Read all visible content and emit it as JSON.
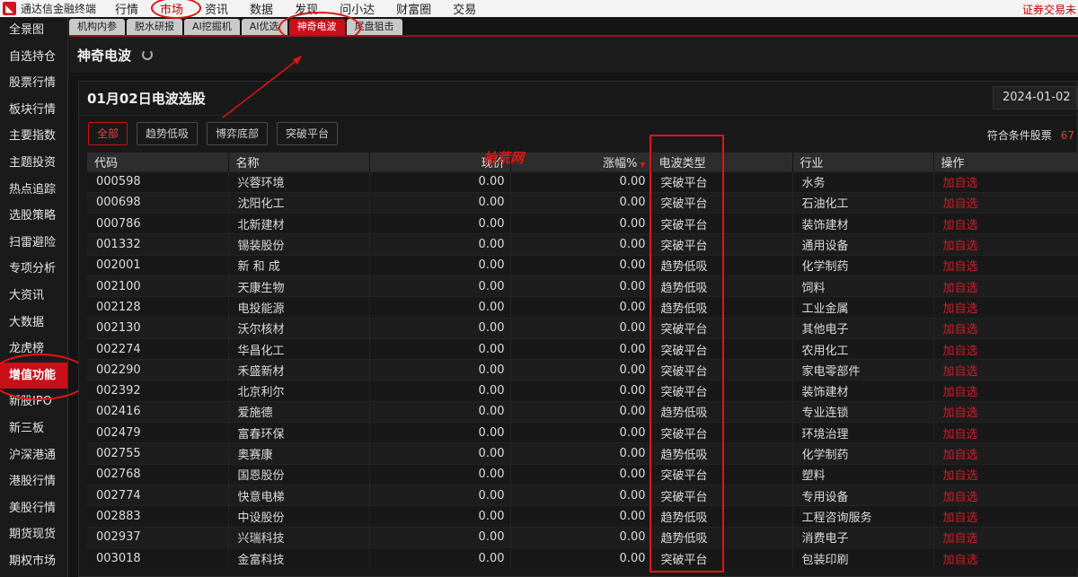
{
  "app": {
    "title": "通达信金融终端",
    "top_right": "证券交易未"
  },
  "top_menu": [
    {
      "label": "行情",
      "active": false
    },
    {
      "label": "市场",
      "active": true
    },
    {
      "label": "资讯",
      "active": false
    },
    {
      "label": "数据",
      "active": false
    },
    {
      "label": "发现",
      "active": false
    },
    {
      "label": "问小达",
      "active": false
    },
    {
      "label": "财富圈",
      "active": false
    },
    {
      "label": "交易",
      "active": false
    }
  ],
  "sidebar": [
    "全景图",
    "自选持仓",
    "股票行情",
    "板块行情",
    "主要指数",
    "主题投资",
    "热点追踪",
    "选股策略",
    "扫雷避险",
    "专项分析",
    "大资讯",
    "大数据",
    "龙虎榜",
    "增值功能",
    "新股IPO",
    "新三板",
    "沪深港通",
    "港股行情",
    "美股行情",
    "期货现货",
    "期权市场"
  ],
  "sidebar_active": "增值功能",
  "tabs": [
    {
      "label": "机构内参",
      "active": false
    },
    {
      "label": "脱水研报",
      "active": false
    },
    {
      "label": "AI挖掘机",
      "active": false
    },
    {
      "label": "AI优选",
      "active": false
    },
    {
      "label": "神奇电波",
      "active": true
    },
    {
      "label": "尾盘狙击",
      "active": false
    }
  ],
  "section_title": "神奇电波",
  "panel": {
    "title": "01月02日电波选股",
    "date": "2024-01-02",
    "filters": [
      {
        "label": "全部",
        "active": true
      },
      {
        "label": "趋势低吸",
        "active": false
      },
      {
        "label": "博弈底部",
        "active": false
      },
      {
        "label": "突破平台",
        "active": false
      }
    ],
    "count_label": "符合条件股票",
    "count_value": "67"
  },
  "watermark": "拾荒网",
  "table": {
    "columns": [
      "代码",
      "名称",
      "现价",
      "涨幅%",
      "电波类型",
      "行业",
      "操作"
    ],
    "rows": [
      [
        "000598",
        "兴蓉环境",
        "0.00",
        "0.00",
        "突破平台",
        "水务",
        "加自选"
      ],
      [
        "000698",
        "沈阳化工",
        "0.00",
        "0.00",
        "突破平台",
        "石油化工",
        "加自选"
      ],
      [
        "000786",
        "北新建材",
        "0.00",
        "0.00",
        "突破平台",
        "装饰建材",
        "加自选"
      ],
      [
        "001332",
        "锡装股份",
        "0.00",
        "0.00",
        "突破平台",
        "通用设备",
        "加自选"
      ],
      [
        "002001",
        "新 和 成",
        "0.00",
        "0.00",
        "趋势低吸",
        "化学制药",
        "加自选"
      ],
      [
        "002100",
        "天康生物",
        "0.00",
        "0.00",
        "趋势低吸",
        "饲料",
        "加自选"
      ],
      [
        "002128",
        "电投能源",
        "0.00",
        "0.00",
        "趋势低吸",
        "工业金属",
        "加自选"
      ],
      [
        "002130",
        "沃尔核材",
        "0.00",
        "0.00",
        "突破平台",
        "其他电子",
        "加自选"
      ],
      [
        "002274",
        "华昌化工",
        "0.00",
        "0.00",
        "突破平台",
        "农用化工",
        "加自选"
      ],
      [
        "002290",
        "禾盛新材",
        "0.00",
        "0.00",
        "突破平台",
        "家电零部件",
        "加自选"
      ],
      [
        "002392",
        "北京利尔",
        "0.00",
        "0.00",
        "突破平台",
        "装饰建材",
        "加自选"
      ],
      [
        "002416",
        "爱施德",
        "0.00",
        "0.00",
        "趋势低吸",
        "专业连锁",
        "加自选"
      ],
      [
        "002479",
        "富春环保",
        "0.00",
        "0.00",
        "突破平台",
        "环境治理",
        "加自选"
      ],
      [
        "002755",
        "奥赛康",
        "0.00",
        "0.00",
        "趋势低吸",
        "化学制药",
        "加自选"
      ],
      [
        "002768",
        "国恩股份",
        "0.00",
        "0.00",
        "突破平台",
        "塑料",
        "加自选"
      ],
      [
        "002774",
        "快意电梯",
        "0.00",
        "0.00",
        "突破平台",
        "专用设备",
        "加自选"
      ],
      [
        "002883",
        "中设股份",
        "0.00",
        "0.00",
        "趋势低吸",
        "工程咨询服务",
        "加自选"
      ],
      [
        "002937",
        "兴瑞科技",
        "0.00",
        "0.00",
        "趋势低吸",
        "消费电子",
        "加自选"
      ],
      [
        "003018",
        "金富科技",
        "0.00",
        "0.00",
        "突破平台",
        "包装印刷",
        "加自选"
      ]
    ]
  }
}
